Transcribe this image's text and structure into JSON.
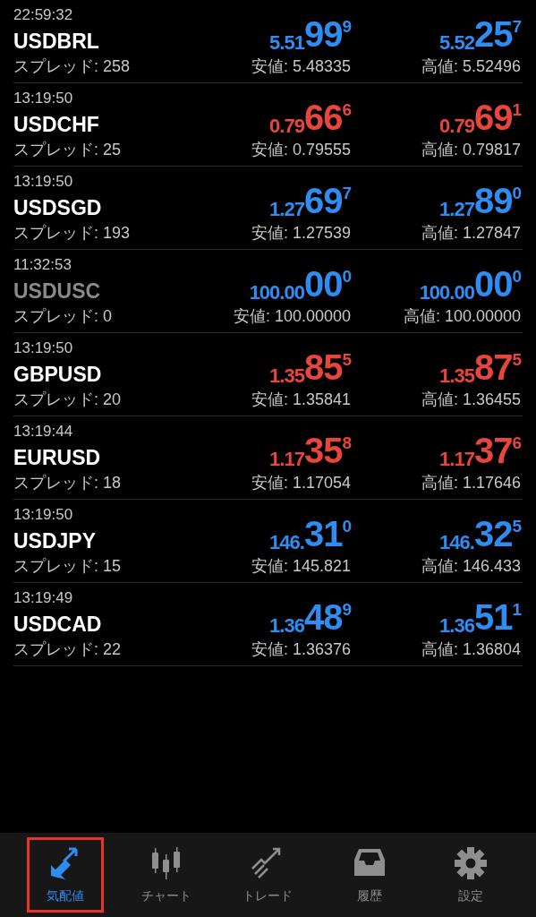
{
  "quotes": [
    {
      "time": "22:59:32",
      "symbol": "USDBRL",
      "disabled": false,
      "spread": "スプレッド: 258",
      "color": "#2f8cf0",
      "bid": {
        "head": "5.51",
        "big": "99",
        "tail": "9"
      },
      "low": "安値: 5.48335",
      "ask": {
        "head": "5.52",
        "big": "25",
        "tail": "7"
      },
      "high": "高値: 5.52496"
    },
    {
      "time": "13:19:50",
      "symbol": "USDCHF",
      "disabled": false,
      "spread": "スプレッド: 25",
      "color": "#e8453c",
      "bid": {
        "head": "0.79",
        "big": "66",
        "tail": "6"
      },
      "low": "安値: 0.79555",
      "ask": {
        "head": "0.79",
        "big": "69",
        "tail": "1"
      },
      "high": "高値: 0.79817"
    },
    {
      "time": "13:19:50",
      "symbol": "USDSGD",
      "disabled": false,
      "spread": "スプレッド: 193",
      "color": "#2f8cf0",
      "bid": {
        "head": "1.27",
        "big": "69",
        "tail": "7"
      },
      "low": "安値: 1.27539",
      "ask": {
        "head": "1.27",
        "big": "89",
        "tail": "0"
      },
      "high": "高値: 1.27847"
    },
    {
      "time": "11:32:53",
      "symbol": "USDUSC",
      "disabled": true,
      "spread": "スプレッド: 0",
      "color": "#2f8cf0",
      "bid": {
        "head": "100.00",
        "big": "00",
        "tail": "0"
      },
      "low": "安値: 100.00000",
      "ask": {
        "head": "100.00",
        "big": "00",
        "tail": "0"
      },
      "high": "高値: 100.00000"
    },
    {
      "time": "13:19:50",
      "symbol": "GBPUSD",
      "disabled": false,
      "spread": "スプレッド: 20",
      "color": "#e8453c",
      "bid": {
        "head": "1.35",
        "big": "85",
        "tail": "5"
      },
      "low": "安値: 1.35841",
      "ask": {
        "head": "1.35",
        "big": "87",
        "tail": "5"
      },
      "high": "高値: 1.36455"
    },
    {
      "time": "13:19:44",
      "symbol": "EURUSD",
      "disabled": false,
      "spread": "スプレッド: 18",
      "color": "#e8453c",
      "bid": {
        "head": "1.17",
        "big": "35",
        "tail": "8"
      },
      "low": "安値: 1.17054",
      "ask": {
        "head": "1.17",
        "big": "37",
        "tail": "6"
      },
      "high": "高値: 1.17646"
    },
    {
      "time": "13:19:50",
      "symbol": "USDJPY",
      "disabled": false,
      "spread": "スプレッド: 15",
      "color": "#2f8cf0",
      "bid": {
        "head": "146.",
        "big": "31",
        "tail": "0"
      },
      "low": "安値: 145.821",
      "ask": {
        "head": "146.",
        "big": "32",
        "tail": "5"
      },
      "high": "高値: 146.433"
    },
    {
      "time": "13:19:49",
      "symbol": "USDCAD",
      "disabled": false,
      "spread": "スプレッド: 22",
      "color": "#2f8cf0",
      "bid": {
        "head": "1.36",
        "big": "48",
        "tail": "9"
      },
      "low": "安値: 1.36376",
      "ask": {
        "head": "1.36",
        "big": "51",
        "tail": "1"
      },
      "high": "高値: 1.36804"
    }
  ],
  "tabs": [
    {
      "kind": "quotes",
      "label": "気配値",
      "selected": true,
      "highlighted": true
    },
    {
      "kind": "chart",
      "label": "チャート",
      "selected": false,
      "highlighted": false
    },
    {
      "kind": "trade",
      "label": "トレード",
      "selected": false,
      "highlighted": false
    },
    {
      "kind": "history",
      "label": "履歴",
      "selected": false,
      "highlighted": false
    },
    {
      "kind": "settings",
      "label": "設定",
      "selected": false,
      "highlighted": false
    }
  ]
}
